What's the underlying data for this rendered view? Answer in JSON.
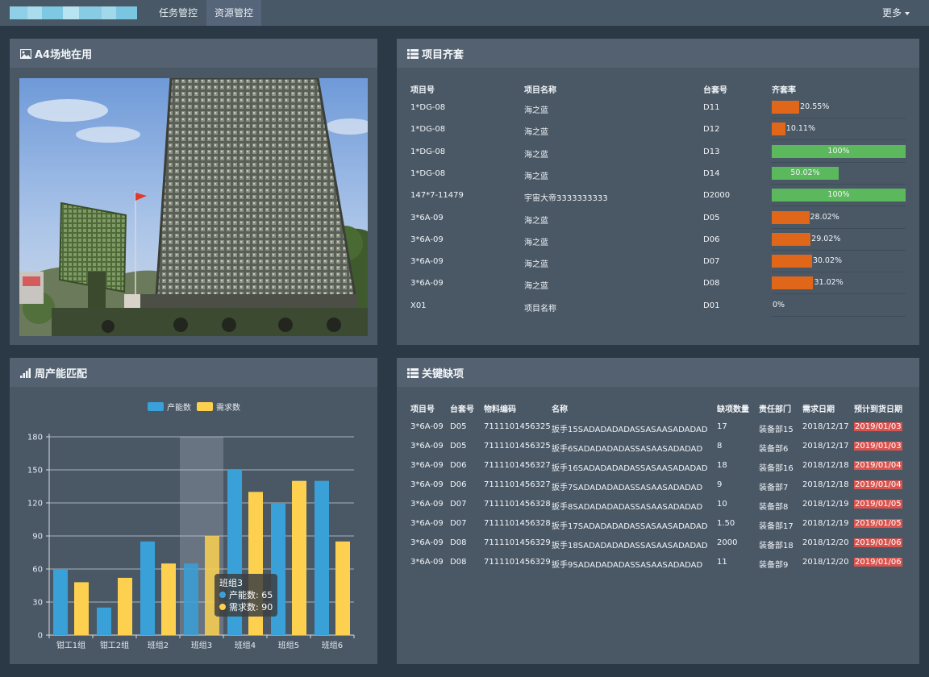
{
  "nav": {
    "tabs": [
      {
        "label": "任务管控",
        "active": false
      },
      {
        "label": "资源管控",
        "active": true
      }
    ],
    "more_label": "更多"
  },
  "panels": {
    "site": {
      "title": "A4场地在用"
    },
    "kitting": {
      "title": "项目齐套"
    },
    "capacity": {
      "title": "周产能匹配"
    },
    "shortage": {
      "title": "关键缺项"
    }
  },
  "kitting_table": {
    "headers": [
      "项目号",
      "项目名称",
      "台套号",
      "齐套率"
    ],
    "rows": [
      {
        "project_no": "1*DG-08",
        "project_name": "海之蓝",
        "set_no": "D11",
        "rate": 20.55,
        "rate_label": "20.55%"
      },
      {
        "project_no": "1*DG-08",
        "project_name": "海之蓝",
        "set_no": "D12",
        "rate": 10.11,
        "rate_label": "10.11%"
      },
      {
        "project_no": "1*DG-08",
        "project_name": "海之蓝",
        "set_no": "D13",
        "rate": 100,
        "rate_label": "100%"
      },
      {
        "project_no": "1*DG-08",
        "project_name": "海之蓝",
        "set_no": "D14",
        "rate": 50.02,
        "rate_label": "50.02%"
      },
      {
        "project_no": "147*7-11479",
        "project_name": "宇宙大帝3333333333",
        "set_no": "D2000",
        "rate": 100,
        "rate_label": "100%"
      },
      {
        "project_no": "3*6A-09",
        "project_name": "海之蓝",
        "set_no": "D05",
        "rate": 28.02,
        "rate_label": "28.02%"
      },
      {
        "project_no": "3*6A-09",
        "project_name": "海之蓝",
        "set_no": "D06",
        "rate": 29.02,
        "rate_label": "29.02%"
      },
      {
        "project_no": "3*6A-09",
        "project_name": "海之蓝",
        "set_no": "D07",
        "rate": 30.02,
        "rate_label": "30.02%"
      },
      {
        "project_no": "3*6A-09",
        "project_name": "海之蓝",
        "set_no": "D08",
        "rate": 31.02,
        "rate_label": "31.02%"
      },
      {
        "project_no": "X01",
        "project_name": "项目名称",
        "set_no": "D01",
        "rate": 0,
        "rate_label": "0%"
      }
    ]
  },
  "shortage_table": {
    "headers": [
      "项目号",
      "台套号",
      "物料编码",
      "名称",
      "缺项数量",
      "责任部门",
      "需求日期",
      "预计到货日期"
    ],
    "rows": [
      [
        "3*6A-09",
        "D05",
        "7111101456325",
        "扳手15SADADADADASSASAASADADAD",
        "17",
        "装备部15",
        "2018/12/17",
        "2019/01/03"
      ],
      [
        "3*6A-09",
        "D05",
        "7111101456325",
        "扳手6SADADADADASSASAASADADAD",
        "8",
        "装备部6",
        "2018/12/17",
        "2019/01/03"
      ],
      [
        "3*6A-09",
        "D06",
        "7111101456327",
        "扳手16SADADADADASSASAASADADAD",
        "18",
        "装备部16",
        "2018/12/18",
        "2019/01/04"
      ],
      [
        "3*6A-09",
        "D06",
        "7111101456327",
        "扳手7SADADADADASSASAASADADAD",
        "9",
        "装备部7",
        "2018/12/18",
        "2019/01/04"
      ],
      [
        "3*6A-09",
        "D07",
        "7111101456328",
        "扳手8SADADADADASSASAASADADAD",
        "10",
        "装备部8",
        "2018/12/19",
        "2019/01/05"
      ],
      [
        "3*6A-09",
        "D07",
        "7111101456328",
        "扳手17SADADADADASSASAASADADAD",
        "1.50",
        "装备部17",
        "2018/12/19",
        "2019/01/05"
      ],
      [
        "3*6A-09",
        "D08",
        "7111101456329",
        "扳手18SADADADADASSASAASADADAD",
        "2000",
        "装备部18",
        "2018/12/20",
        "2019/01/06"
      ],
      [
        "3*6A-09",
        "D08",
        "7111101456329",
        "扳手9SADADADADASSASAASADADAD",
        "11",
        "装备部9",
        "2018/12/20",
        "2019/01/06"
      ]
    ]
  },
  "colors": {
    "blue": "#3aa0d8",
    "yellow": "#fdd14f",
    "orange": "#e0661a",
    "green": "#5cb85c",
    "red_badge": "#d9534f"
  },
  "chart_data": {
    "type": "bar",
    "categories": [
      "钳工1组",
      "钳工2组",
      "班组2",
      "班组3",
      "班组4",
      "班组5",
      "班组6"
    ],
    "series": [
      {
        "name": "产能数",
        "values": [
          60,
          25,
          85,
          65,
          150,
          120,
          140
        ]
      },
      {
        "name": "需求数",
        "values": [
          48,
          52,
          65,
          90,
          130,
          140,
          85
        ]
      }
    ],
    "ylim": [
      0,
      180
    ],
    "yticks": [
      "0",
      "30",
      "60",
      "90",
      "120",
      "150",
      "180"
    ],
    "grid": true,
    "legend": "top-center",
    "tooltip": {
      "title": "班组3",
      "lines": [
        "产能数: 65",
        "需求数: 90"
      ]
    }
  }
}
